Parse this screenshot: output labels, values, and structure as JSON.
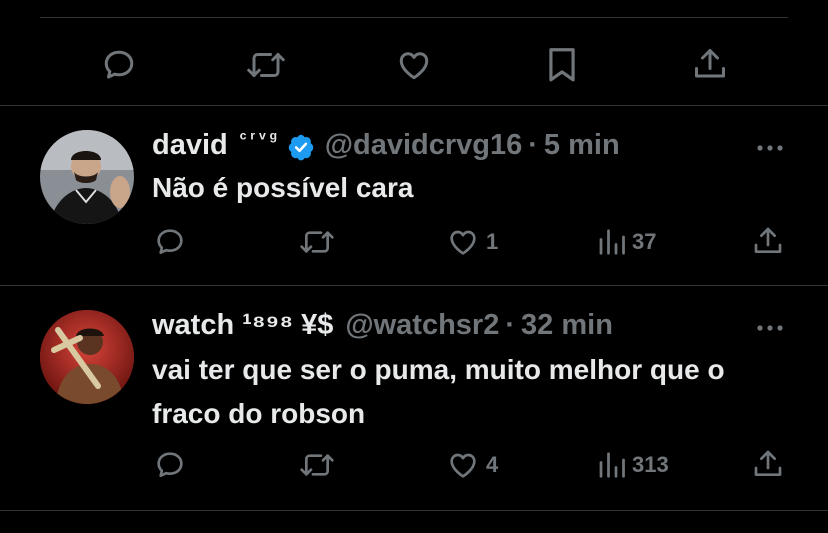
{
  "top_actions": {
    "icons": [
      "reply-icon",
      "retweet-icon",
      "like-icon",
      "bookmark-icon",
      "share-icon"
    ]
  },
  "tweets": [
    {
      "display_name": "david",
      "name_suffix": "ᶜʳᵛᵍ",
      "verified": true,
      "handle": "@davidcrvg16",
      "separator": "·",
      "time": "5 min",
      "text": "Não é possível cara",
      "replies": "",
      "retweets": "",
      "likes": "1",
      "views": "37"
    },
    {
      "display_name": "watch",
      "name_suffix": "¹⁸⁹⁸ ¥$",
      "verified": false,
      "handle": "@watchsr2",
      "separator": "·",
      "time": "32 min",
      "text": "vai ter que ser o puma, muito melhor que o fraco do robson",
      "replies": "",
      "retweets": "",
      "likes": "4",
      "views": "313"
    }
  ],
  "colors": {
    "background": "#000000",
    "text": "#e7e9ea",
    "muted": "#71767b",
    "verified": "#1d9bf0",
    "divider": "#2f3336"
  }
}
